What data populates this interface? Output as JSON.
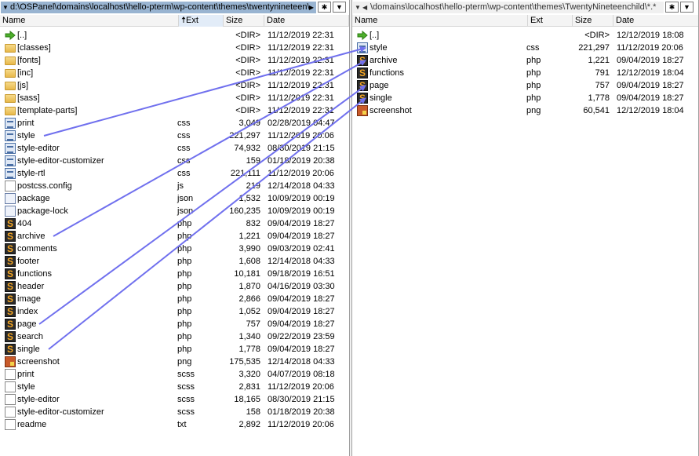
{
  "left": {
    "path": "d:\\OSPanel\\domains\\localhost\\hello-pterm\\wp-content\\themes\\twentynineteen\\*.*",
    "columns": {
      "name": "Name",
      "ext": "Ext",
      "size": "Size",
      "date": "Date"
    },
    "rows": [
      {
        "name": "[..]",
        "ext": "",
        "size": "<DIR>",
        "date": "11/12/2019 22:31",
        "icon": "up-icon"
      },
      {
        "name": "[classes]",
        "ext": "",
        "size": "<DIR>",
        "date": "11/12/2019 22:31",
        "icon": "folder-icon"
      },
      {
        "name": "[fonts]",
        "ext": "",
        "size": "<DIR>",
        "date": "11/12/2019 22:31",
        "icon": "folder-icon"
      },
      {
        "name": "[inc]",
        "ext": "",
        "size": "<DIR>",
        "date": "11/12/2019 22:31",
        "icon": "folder-icon"
      },
      {
        "name": "[js]",
        "ext": "",
        "size": "<DIR>",
        "date": "11/12/2019 22:31",
        "icon": "folder-icon"
      },
      {
        "name": "[sass]",
        "ext": "",
        "size": "<DIR>",
        "date": "11/12/2019 22:31",
        "icon": "folder-icon"
      },
      {
        "name": "[template-parts]",
        "ext": "",
        "size": "<DIR>",
        "date": "11/12/2019 22:31",
        "icon": "folder-icon"
      },
      {
        "name": "print",
        "ext": "css",
        "size": "3,049",
        "date": "02/28/2019 04:47",
        "icon": "css-file-icon"
      },
      {
        "name": "style",
        "ext": "css",
        "size": "221,297",
        "date": "11/12/2019 20:06",
        "icon": "css-file-icon"
      },
      {
        "name": "style-editor",
        "ext": "css",
        "size": "74,932",
        "date": "08/30/2019 21:15",
        "icon": "css-file-icon"
      },
      {
        "name": "style-editor-customizer",
        "ext": "css",
        "size": "159",
        "date": "01/18/2019 20:38",
        "icon": "css-file-icon"
      },
      {
        "name": "style-rtl",
        "ext": "css",
        "size": "221,111",
        "date": "11/12/2019 20:06",
        "icon": "css-file-icon"
      },
      {
        "name": "postcss.config",
        "ext": "js",
        "size": "219",
        "date": "12/14/2018 04:33",
        "icon": "js-file-icon"
      },
      {
        "name": "package",
        "ext": "json",
        "size": "1,532",
        "date": "10/09/2019 00:19",
        "icon": "json-file-icon"
      },
      {
        "name": "package-lock",
        "ext": "json",
        "size": "160,235",
        "date": "10/09/2019 00:19",
        "icon": "json-file-icon"
      },
      {
        "name": "404",
        "ext": "php",
        "size": "832",
        "date": "09/04/2019 18:27",
        "icon": "php-file-icon"
      },
      {
        "name": "archive",
        "ext": "php",
        "size": "1,221",
        "date": "09/04/2019 18:27",
        "icon": "php-file-icon"
      },
      {
        "name": "comments",
        "ext": "php",
        "size": "3,990",
        "date": "09/03/2019 02:41",
        "icon": "php-file-icon"
      },
      {
        "name": "footer",
        "ext": "php",
        "size": "1,608",
        "date": "12/14/2018 04:33",
        "icon": "php-file-icon"
      },
      {
        "name": "functions",
        "ext": "php",
        "size": "10,181",
        "date": "09/18/2019 16:51",
        "icon": "php-file-icon"
      },
      {
        "name": "header",
        "ext": "php",
        "size": "1,870",
        "date": "04/16/2019 03:30",
        "icon": "php-file-icon"
      },
      {
        "name": "image",
        "ext": "php",
        "size": "2,866",
        "date": "09/04/2019 18:27",
        "icon": "php-file-icon"
      },
      {
        "name": "index",
        "ext": "php",
        "size": "1,052",
        "date": "09/04/2019 18:27",
        "icon": "php-file-icon"
      },
      {
        "name": "page",
        "ext": "php",
        "size": "757",
        "date": "09/04/2019 18:27",
        "icon": "php-file-icon"
      },
      {
        "name": "search",
        "ext": "php",
        "size": "1,340",
        "date": "09/22/2019 23:59",
        "icon": "php-file-icon"
      },
      {
        "name": "single",
        "ext": "php",
        "size": "1,778",
        "date": "09/04/2019 18:27",
        "icon": "php-file-icon"
      },
      {
        "name": "screenshot",
        "ext": "png",
        "size": "175,535",
        "date": "12/14/2018 04:33",
        "icon": "png-file-icon"
      },
      {
        "name": "print",
        "ext": "scss",
        "size": "3,320",
        "date": "04/07/2019 08:18",
        "icon": "scss-file-icon"
      },
      {
        "name": "style",
        "ext": "scss",
        "size": "2,831",
        "date": "11/12/2019 20:06",
        "icon": "scss-file-icon"
      },
      {
        "name": "style-editor",
        "ext": "scss",
        "size": "18,165",
        "date": "08/30/2019 21:15",
        "icon": "scss-file-icon"
      },
      {
        "name": "style-editor-customizer",
        "ext": "scss",
        "size": "158",
        "date": "01/18/2019 20:38",
        "icon": "scss-file-icon"
      },
      {
        "name": "readme",
        "ext": "txt",
        "size": "2,892",
        "date": "11/12/2019 20:06",
        "icon": "txt-file-icon"
      }
    ]
  },
  "right": {
    "path": "\\domains\\localhost\\hello-pterm\\wp-content\\themes\\TwentyNineteenchild\\*.*",
    "columns": {
      "name": "Name",
      "ext": "Ext",
      "size": "Size",
      "date": "Date"
    },
    "rows": [
      {
        "name": "[..]",
        "ext": "",
        "size": "<DIR>",
        "date": "12/12/2019 18:08",
        "icon": "up-icon"
      },
      {
        "name": "style",
        "ext": "css",
        "size": "221,297",
        "date": "11/12/2019 20:06",
        "icon": "css-file-icon"
      },
      {
        "name": "archive",
        "ext": "php",
        "size": "1,221",
        "date": "09/04/2019 18:27",
        "icon": "php-file-icon"
      },
      {
        "name": "functions",
        "ext": "php",
        "size": "791",
        "date": "12/12/2019 18:04",
        "icon": "php-file-icon"
      },
      {
        "name": "page",
        "ext": "php",
        "size": "757",
        "date": "09/04/2019 18:27",
        "icon": "php-file-icon"
      },
      {
        "name": "single",
        "ext": "php",
        "size": "1,778",
        "date": "09/04/2019 18:27",
        "icon": "php-file-icon"
      },
      {
        "name": "screenshot",
        "ext": "png",
        "size": "60,541",
        "date": "12/12/2019 18:04",
        "icon": "png-file-icon"
      }
    ]
  },
  "buttons": {
    "star": "✱",
    "menu": "▼"
  },
  "arrow_color": "#7070ee",
  "copied_files": [
    {
      "from": "style",
      "to": "style"
    },
    {
      "from": "archive",
      "to": "archive"
    },
    {
      "from": "page",
      "to": "page"
    },
    {
      "from": "single",
      "to": "single"
    }
  ]
}
